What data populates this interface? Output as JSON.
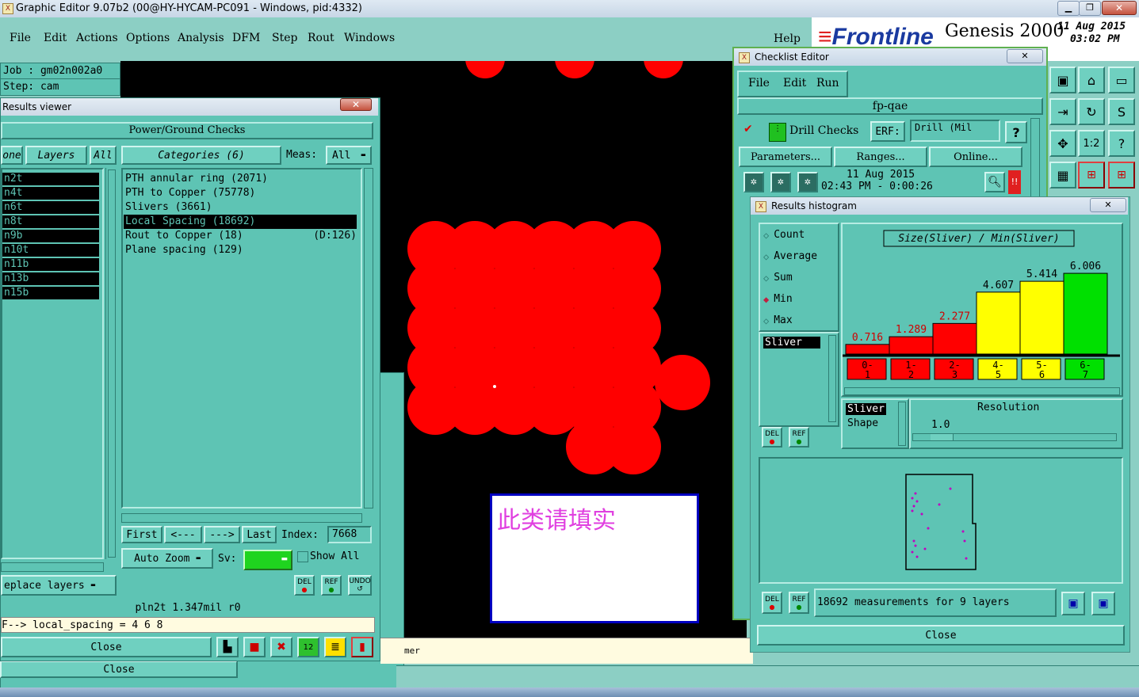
{
  "app": {
    "title": "Graphic Editor 9.07b2 (00@HY-HYCAM-PC091 - Windows, pid:4332)",
    "menu": [
      "File",
      "Edit",
      "Actions",
      "Options",
      "Analysis",
      "DFM",
      "Step",
      "Rout",
      "Windows"
    ],
    "help": "Help",
    "brand": "Frontline",
    "product": "Genesis 2000",
    "date": "11 Aug 2015",
    "time": "03:02 PM"
  },
  "job": {
    "job_label": "Job : gm02n002a0",
    "step_label": "Step: cam"
  },
  "results_viewer": {
    "title": "Results viewer",
    "header": "Power/Ground Checks",
    "tab_none": "one",
    "tab_layers": "Layers",
    "tab_all": "All",
    "categories_label": "Categories (6)",
    "meas_label": "Meas:",
    "meas_value": "All",
    "layers": [
      "n2t",
      "n4t",
      "n6t",
      "n8t",
      "n9b",
      "n10t",
      "n11b",
      "n13b",
      "n15b"
    ],
    "categories": [
      {
        "text": "PTH annular ring (2071)",
        "extra": ""
      },
      {
        "text": "PTH to Copper (75778)",
        "extra": ""
      },
      {
        "text": "Slivers (3661)",
        "extra": ""
      },
      {
        "text": "Local Spacing (18692)",
        "extra": ""
      },
      {
        "text": "Rout to Copper (18)",
        "extra": "(D:126)"
      },
      {
        "text": "Plane spacing (129)",
        "extra": ""
      }
    ],
    "selected_category_index": 3,
    "first": "First",
    "prev": "<---",
    "next": "--->",
    "last": "Last",
    "index_label": "Index:",
    "index_value": "7668",
    "auto_zoom": "Auto Zoom",
    "sv_label": "Sv:",
    "show_all": "Show All",
    "replace_layers": "eplace layers",
    "status1": "pln2t 1.347mil  r0",
    "status2": "F--> local_spacing = 4 6 8",
    "close": "Close",
    "del": "DEL",
    "ref": "REF",
    "undo": "UNDO"
  },
  "background_close": "Close",
  "bottom_hint": "mer",
  "popup_text": "此类请填实",
  "checklist": {
    "title": "Checklist Editor",
    "menu": [
      "File",
      "Edit",
      "Run"
    ],
    "name": "fp-qae",
    "drill_checks": "Drill Checks",
    "erf_label": "ERF:",
    "erf_value": "Drill (Mil",
    "help": "?",
    "parameters": "Parameters...",
    "ranges": "Ranges...",
    "online": "Online...",
    "run_date": "11 Aug 2015",
    "run_time": "02:43 PM - 0:00:26"
  },
  "histogram": {
    "title": "Results histogram",
    "modes": [
      "Count",
      "Average",
      "Sum",
      "Min",
      "Max"
    ],
    "selected_mode": "Min",
    "item_list": [
      "Sliver"
    ],
    "chart_title": "Size(Sliver) / Min(Sliver)",
    "resolution_label": "Resolution",
    "resolution_value": "1.0",
    "list2": [
      "Sliver",
      "Shape"
    ],
    "measurements": "18692 measurements for 9 layers",
    "close": "Close",
    "del": "DEL",
    "ref": "REF"
  },
  "chart_data": {
    "type": "bar",
    "title": "Size(Sliver) / Min(Sliver)",
    "categories": [
      "0-1",
      "1-2",
      "2-3",
      "4-5",
      "5-6",
      "6-7"
    ],
    "values": [
      0.716,
      1.289,
      2.277,
      4.607,
      5.414,
      6.006
    ],
    "labels": [
      "0.716",
      "1.289",
      "2.277",
      "4.607",
      "5.414",
      "6.006"
    ],
    "colors": [
      "#ff0000",
      "#ff0000",
      "#ff0000",
      "#ffff00",
      "#ffff00",
      "#00e000"
    ],
    "label_colors": [
      "#d00000",
      "#d00000",
      "#d00000",
      "#000000",
      "#000000",
      "#000000"
    ],
    "ylim": [
      0,
      6.6
    ],
    "grid": false
  }
}
